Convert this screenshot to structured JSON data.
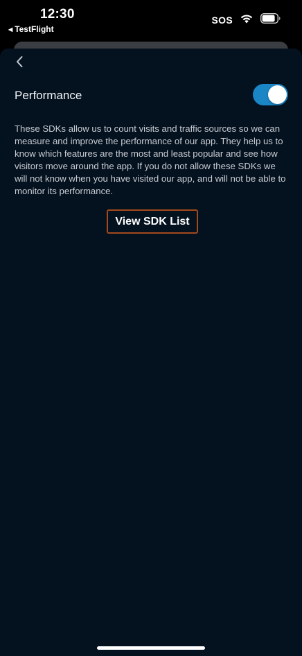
{
  "status_bar": {
    "time": "12:30",
    "back_app_label": "TestFlight",
    "sos_label": "SOS",
    "icons": [
      "wifi-icon",
      "battery-icon"
    ]
  },
  "settings": {
    "title": "Performance",
    "toggle_on": true,
    "description": "These SDKs allow us to count visits and traffic sources so we can measure and improve the performance of our app. They help us to know which features are the most and least popular and see how visitors move around the app. If you do not allow these SDKs we will not know when you have visited our app, and will not be able to monitor its performance.",
    "sdk_button_label": "View SDK List"
  },
  "colors": {
    "background": "#04111f",
    "toggle_accent": "#1b86c6",
    "button_border": "#a44a1c"
  }
}
